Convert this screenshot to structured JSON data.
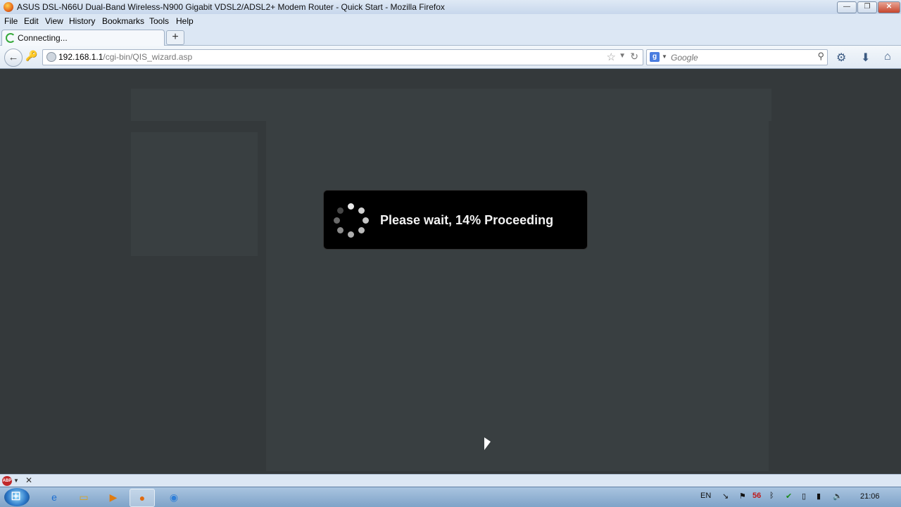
{
  "window": {
    "title": "ASUS DSL-N66U Dual-Band Wireless-N900 Gigabit VDSL2/ADSL2+ Modem Router - Quick Start - Mozilla Firefox",
    "minimize": "—",
    "restore": "❐",
    "close": "✕"
  },
  "menu": [
    "File",
    "Edit",
    "View",
    "History",
    "Bookmarks",
    "Tools",
    "Help"
  ],
  "tab": {
    "label": "Connecting...",
    "close": "×",
    "new_tab": "+"
  },
  "address": {
    "host": "192.168.1.1",
    "path": "/cgi-bin/QIS_wizard.asp"
  },
  "search": {
    "placeholder": "Google"
  },
  "modal": {
    "message": "Please wait, 14% Proceeding",
    "progress_percent": 14
  },
  "taskbar": {
    "language": "EN",
    "tray_badge": "56",
    "clock": "21:06"
  },
  "colors": {
    "overlay": "#34393b",
    "modal_bg": "#000000",
    "modal_text": "#f2f2f2"
  }
}
